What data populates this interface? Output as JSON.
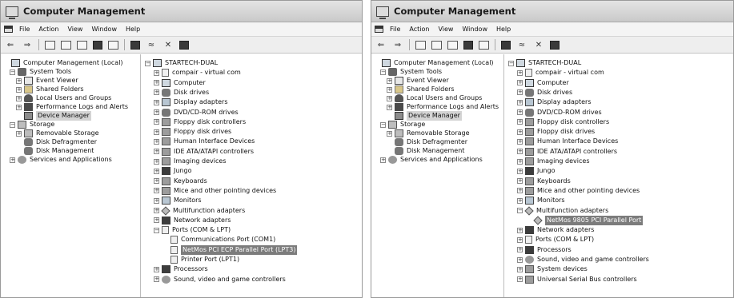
{
  "left_window": {
    "title": "Computer Management",
    "menu": [
      "File",
      "Action",
      "View",
      "Window",
      "Help"
    ],
    "left_tree": [
      {
        "label": "Computer Management (Local)",
        "depth": 0,
        "icon": "computer-icon",
        "expander": ""
      },
      {
        "label": "System Tools",
        "depth": 1,
        "icon": "tools-icon",
        "expander": "-"
      },
      {
        "label": "Event Viewer",
        "depth": 2,
        "icon": "event-viewer-icon",
        "expander": "+"
      },
      {
        "label": "Shared Folders",
        "depth": 2,
        "icon": "shared-folders-icon",
        "expander": "+"
      },
      {
        "label": "Local Users and Groups",
        "depth": 2,
        "icon": "users-icon",
        "expander": "+"
      },
      {
        "label": "Performance Logs and Alerts",
        "depth": 2,
        "icon": "performance-icon",
        "expander": "+"
      },
      {
        "label": "Device Manager",
        "depth": 2,
        "icon": "device-manager-icon",
        "expander": "",
        "selected_gray": true
      },
      {
        "label": "Storage",
        "depth": 1,
        "icon": "storage-icon",
        "expander": "-"
      },
      {
        "label": "Removable Storage",
        "depth": 2,
        "icon": "removable-storage-icon",
        "expander": "+"
      },
      {
        "label": "Disk Defragmenter",
        "depth": 2,
        "icon": "defragmenter-icon",
        "expander": ""
      },
      {
        "label": "Disk Management",
        "depth": 2,
        "icon": "disk-management-icon",
        "expander": ""
      },
      {
        "label": "Services and Applications",
        "depth": 1,
        "icon": "services-icon",
        "expander": "+"
      }
    ],
    "right_tree": [
      {
        "label": "STARTECH-DUAL",
        "depth": 0,
        "icon": "computer-icon",
        "expander": "-"
      },
      {
        "label": "compair - virtual com",
        "depth": 1,
        "icon": "port-icon",
        "expander": "+"
      },
      {
        "label": "Computer",
        "depth": 1,
        "icon": "computer-icon",
        "expander": "+"
      },
      {
        "label": "Disk drives",
        "depth": 1,
        "icon": "disk-icon",
        "expander": "+"
      },
      {
        "label": "Display adapters",
        "depth": 1,
        "icon": "display-icon",
        "expander": "+"
      },
      {
        "label": "DVD/CD-ROM drives",
        "depth": 1,
        "icon": "cdrom-icon",
        "expander": "+"
      },
      {
        "label": "Floppy disk controllers",
        "depth": 1,
        "icon": "controller-icon",
        "expander": "+"
      },
      {
        "label": "Floppy disk drives",
        "depth": 1,
        "icon": "floppy-icon",
        "expander": "+"
      },
      {
        "label": "Human Interface Devices",
        "depth": 1,
        "icon": "hid-icon",
        "expander": "+"
      },
      {
        "label": "IDE ATA/ATAPI controllers",
        "depth": 1,
        "icon": "controller-icon",
        "expander": "+"
      },
      {
        "label": "Imaging devices",
        "depth": 1,
        "icon": "imaging-icon",
        "expander": "+"
      },
      {
        "label": "Jungo",
        "depth": 1,
        "icon": "chip-icon",
        "expander": "+"
      },
      {
        "label": "Keyboards",
        "depth": 1,
        "icon": "keyboard-icon",
        "expander": "+"
      },
      {
        "label": "Mice and other pointing devices",
        "depth": 1,
        "icon": "mouse-icon",
        "expander": "+"
      },
      {
        "label": "Monitors",
        "depth": 1,
        "icon": "monitor-icon",
        "expander": "+"
      },
      {
        "label": "Multifunction adapters",
        "depth": 1,
        "icon": "multifunction-icon",
        "expander": "+"
      },
      {
        "label": "Network adapters",
        "depth": 1,
        "icon": "network-icon",
        "expander": "+"
      },
      {
        "label": "Ports (COM & LPT)",
        "depth": 1,
        "icon": "port-icon",
        "expander": "-"
      },
      {
        "label": "Communications Port (COM1)",
        "depth": 2,
        "icon": "port-icon",
        "expander": ""
      },
      {
        "label": "NetMos PCI ECP Parallel Port (LPT3)",
        "depth": 2,
        "icon": "port-icon",
        "expander": "",
        "selected": true
      },
      {
        "label": "Printer Port (LPT1)",
        "depth": 2,
        "icon": "port-icon",
        "expander": ""
      },
      {
        "label": "Processors",
        "depth": 1,
        "icon": "processor-icon",
        "expander": "+"
      },
      {
        "label": "Sound, video and game controllers",
        "depth": 1,
        "icon": "sound-icon",
        "expander": "+"
      }
    ]
  },
  "right_window": {
    "title": "Computer Management",
    "menu": [
      "File",
      "Action",
      "View",
      "Window",
      "Help"
    ],
    "left_tree": [
      {
        "label": "Computer Management (Local)",
        "depth": 0,
        "icon": "computer-icon",
        "expander": ""
      },
      {
        "label": "System Tools",
        "depth": 1,
        "icon": "tools-icon",
        "expander": "-"
      },
      {
        "label": "Event Viewer",
        "depth": 2,
        "icon": "event-viewer-icon",
        "expander": "+"
      },
      {
        "label": "Shared Folders",
        "depth": 2,
        "icon": "shared-folders-icon",
        "expander": "+"
      },
      {
        "label": "Local Users and Groups",
        "depth": 2,
        "icon": "users-icon",
        "expander": "+"
      },
      {
        "label": "Performance Logs and Alerts",
        "depth": 2,
        "icon": "performance-icon",
        "expander": "+"
      },
      {
        "label": "Device Manager",
        "depth": 2,
        "icon": "device-manager-icon",
        "expander": "",
        "selected_gray": true
      },
      {
        "label": "Storage",
        "depth": 1,
        "icon": "storage-icon",
        "expander": "-"
      },
      {
        "label": "Removable Storage",
        "depth": 2,
        "icon": "removable-storage-icon",
        "expander": "+"
      },
      {
        "label": "Disk Defragmenter",
        "depth": 2,
        "icon": "defragmenter-icon",
        "expander": ""
      },
      {
        "label": "Disk Management",
        "depth": 2,
        "icon": "disk-management-icon",
        "expander": ""
      },
      {
        "label": "Services and Applications",
        "depth": 1,
        "icon": "services-icon",
        "expander": "+"
      }
    ],
    "right_tree": [
      {
        "label": "STARTECH-DUAL",
        "depth": 0,
        "icon": "computer-icon",
        "expander": "-"
      },
      {
        "label": "compair - virtual com",
        "depth": 1,
        "icon": "port-icon",
        "expander": "+"
      },
      {
        "label": "Computer",
        "depth": 1,
        "icon": "computer-icon",
        "expander": "+"
      },
      {
        "label": "Disk drives",
        "depth": 1,
        "icon": "disk-icon",
        "expander": "+"
      },
      {
        "label": "Display adapters",
        "depth": 1,
        "icon": "display-icon",
        "expander": "+"
      },
      {
        "label": "DVD/CD-ROM drives",
        "depth": 1,
        "icon": "cdrom-icon",
        "expander": "+"
      },
      {
        "label": "Floppy disk controllers",
        "depth": 1,
        "icon": "controller-icon",
        "expander": "+"
      },
      {
        "label": "Floppy disk drives",
        "depth": 1,
        "icon": "floppy-icon",
        "expander": "+"
      },
      {
        "label": "Human Interface Devices",
        "depth": 1,
        "icon": "hid-icon",
        "expander": "+"
      },
      {
        "label": "IDE ATA/ATAPI controllers",
        "depth": 1,
        "icon": "controller-icon",
        "expander": "+"
      },
      {
        "label": "Imaging devices",
        "depth": 1,
        "icon": "imaging-icon",
        "expander": "+"
      },
      {
        "label": "Jungo",
        "depth": 1,
        "icon": "chip-icon",
        "expander": "+"
      },
      {
        "label": "Keyboards",
        "depth": 1,
        "icon": "keyboard-icon",
        "expander": "+"
      },
      {
        "label": "Mice and other pointing devices",
        "depth": 1,
        "icon": "mouse-icon",
        "expander": "+"
      },
      {
        "label": "Monitors",
        "depth": 1,
        "icon": "monitor-icon",
        "expander": "+"
      },
      {
        "label": "Multifunction adapters",
        "depth": 1,
        "icon": "multifunction-icon",
        "expander": "-"
      },
      {
        "label": "NetMos 9805 PCI Parallel Port",
        "depth": 2,
        "icon": "diamond-device-icon",
        "expander": "",
        "selected": true
      },
      {
        "label": "Network adapters",
        "depth": 1,
        "icon": "network-icon",
        "expander": "+"
      },
      {
        "label": "Ports (COM & LPT)",
        "depth": 1,
        "icon": "port-icon",
        "expander": "+"
      },
      {
        "label": "Processors",
        "depth": 1,
        "icon": "processor-icon",
        "expander": "+"
      },
      {
        "label": "Sound, video and game controllers",
        "depth": 1,
        "icon": "sound-icon",
        "expander": "+"
      },
      {
        "label": "System devices",
        "depth": 1,
        "icon": "system-devices-icon",
        "expander": "+"
      },
      {
        "label": "Universal Serial Bus controllers",
        "depth": 1,
        "icon": "usb-icon",
        "expander": "+"
      }
    ]
  },
  "colors": {
    "selection": "#7c7c7c",
    "selection_text": "#ffffff"
  }
}
